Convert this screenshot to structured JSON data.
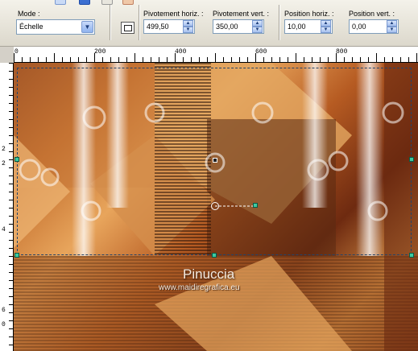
{
  "toolbar": {
    "mode_label": "Mode :",
    "mode_value": "Échelle",
    "pivot_h_label": "Pivotement horiz. :",
    "pivot_h_value": "499,50",
    "pivot_v_label": "Pivotement vert. :",
    "pivot_v_value": "350,00",
    "pos_h_label": "Position horiz. :",
    "pos_h_value": "10,00",
    "pos_v_label": "Position vert. :",
    "pos_v_value": "0,00"
  },
  "ruler": {
    "h_labels": [
      "0",
      "200",
      "400",
      "600",
      "800"
    ],
    "v_labels": [
      "2",
      "2",
      "4",
      "6",
      "0"
    ]
  },
  "watermark": {
    "name": "Pinuccia",
    "url": "www.maidiregrafica.eu"
  },
  "colors": {
    "accent": "#3c6fd1",
    "handle": "#3cc9a0"
  }
}
